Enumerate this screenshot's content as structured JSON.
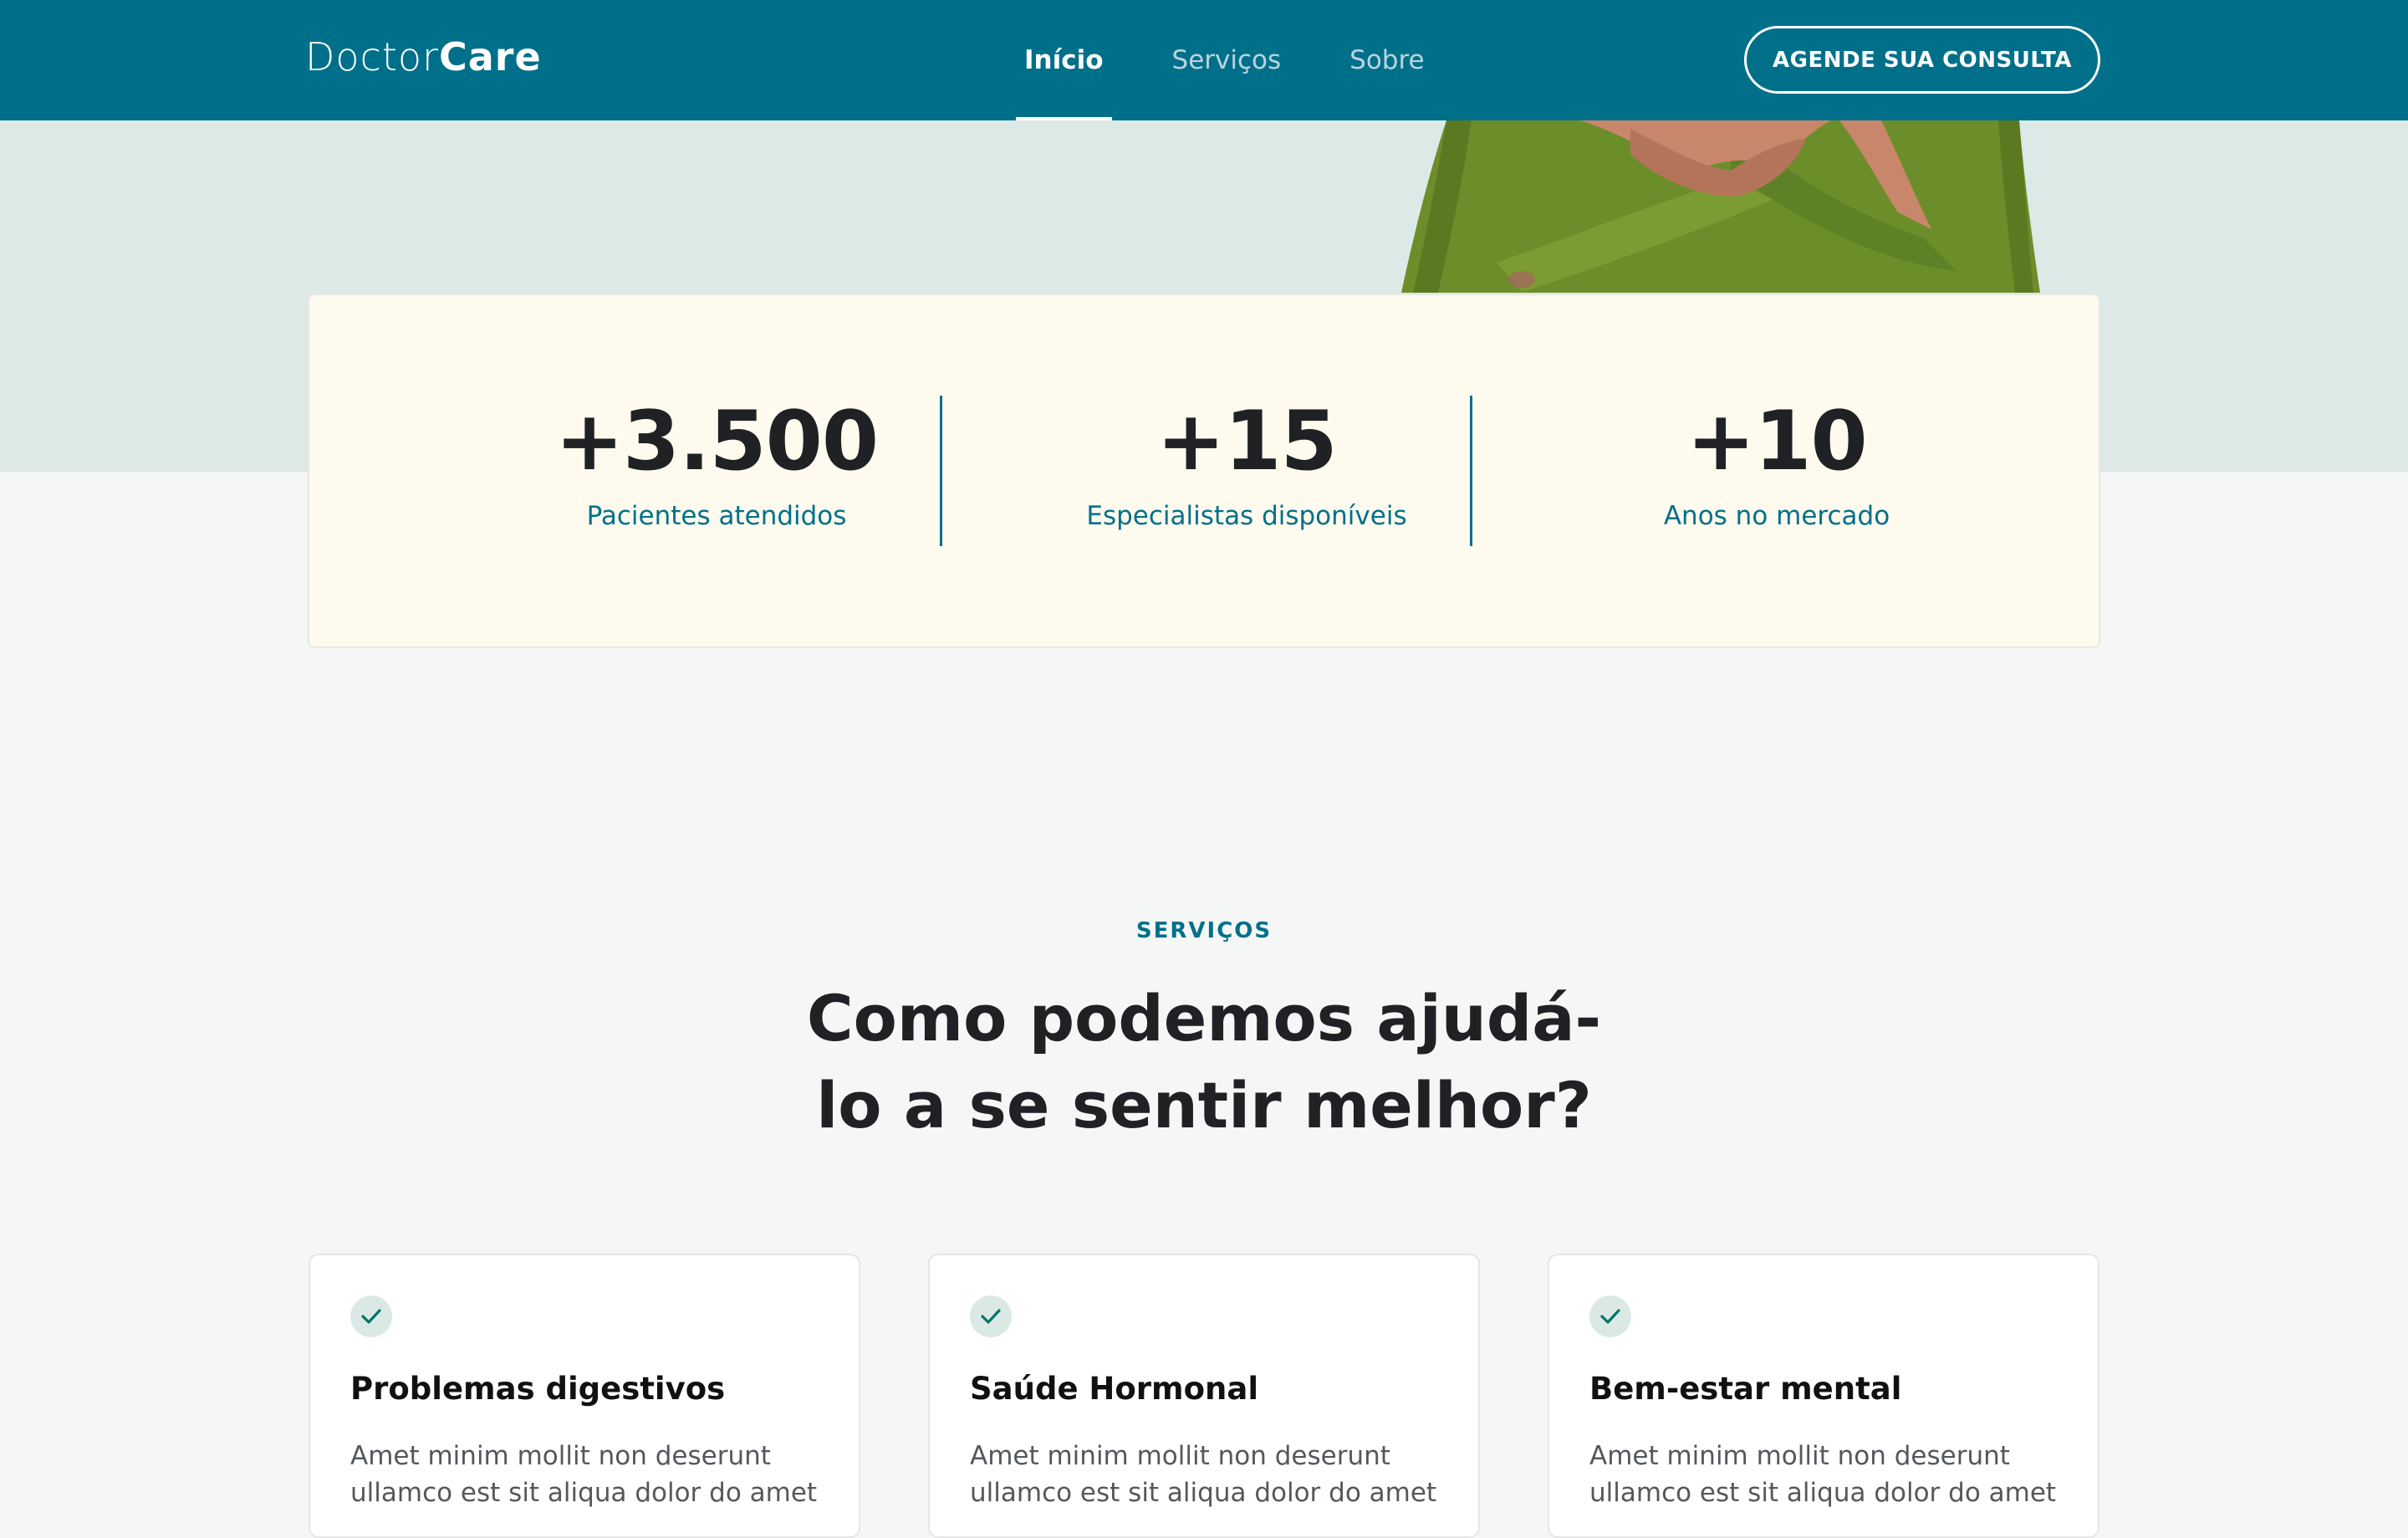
{
  "header": {
    "logo_part1": "Doctor",
    "logo_part2": "Care",
    "nav": [
      {
        "label": "Início",
        "active": true
      },
      {
        "label": "Serviços",
        "active": false
      },
      {
        "label": "Sobre",
        "active": false
      }
    ],
    "cta_label": "AGENDE SUA CONSULTA"
  },
  "stats": [
    {
      "value": "+3.500",
      "label": "Pacientes atendidos"
    },
    {
      "value": "+15",
      "label": "Especialistas disponíveis"
    },
    {
      "value": "+10",
      "label": "Anos no mercado"
    }
  ],
  "services": {
    "tag": "SERVIÇOS",
    "title_line1": "Como podemos ajudá-",
    "title_line2": "lo a se sentir melhor?",
    "cards": [
      {
        "icon": "check-icon",
        "title": "Problemas digestivos",
        "text": "Amet minim mollit non deserunt ullamco est sit aliqua dolor do amet"
      },
      {
        "icon": "check-icon",
        "title": "Saúde Hormonal",
        "text": "Amet minim mollit non deserunt ullamco est sit aliqua dolor do amet"
      },
      {
        "icon": "check-icon",
        "title": "Bem-estar mental",
        "text": "Amet minim mollit non deserunt ullamco est sit aliqua dolor do amet"
      }
    ]
  },
  "colors": {
    "primary": "#00708a",
    "hero_bg": "#dde9e6",
    "stats_bg": "#fefaee",
    "page_bg": "#f5f7f6",
    "sweater": "#6c8e2a"
  }
}
